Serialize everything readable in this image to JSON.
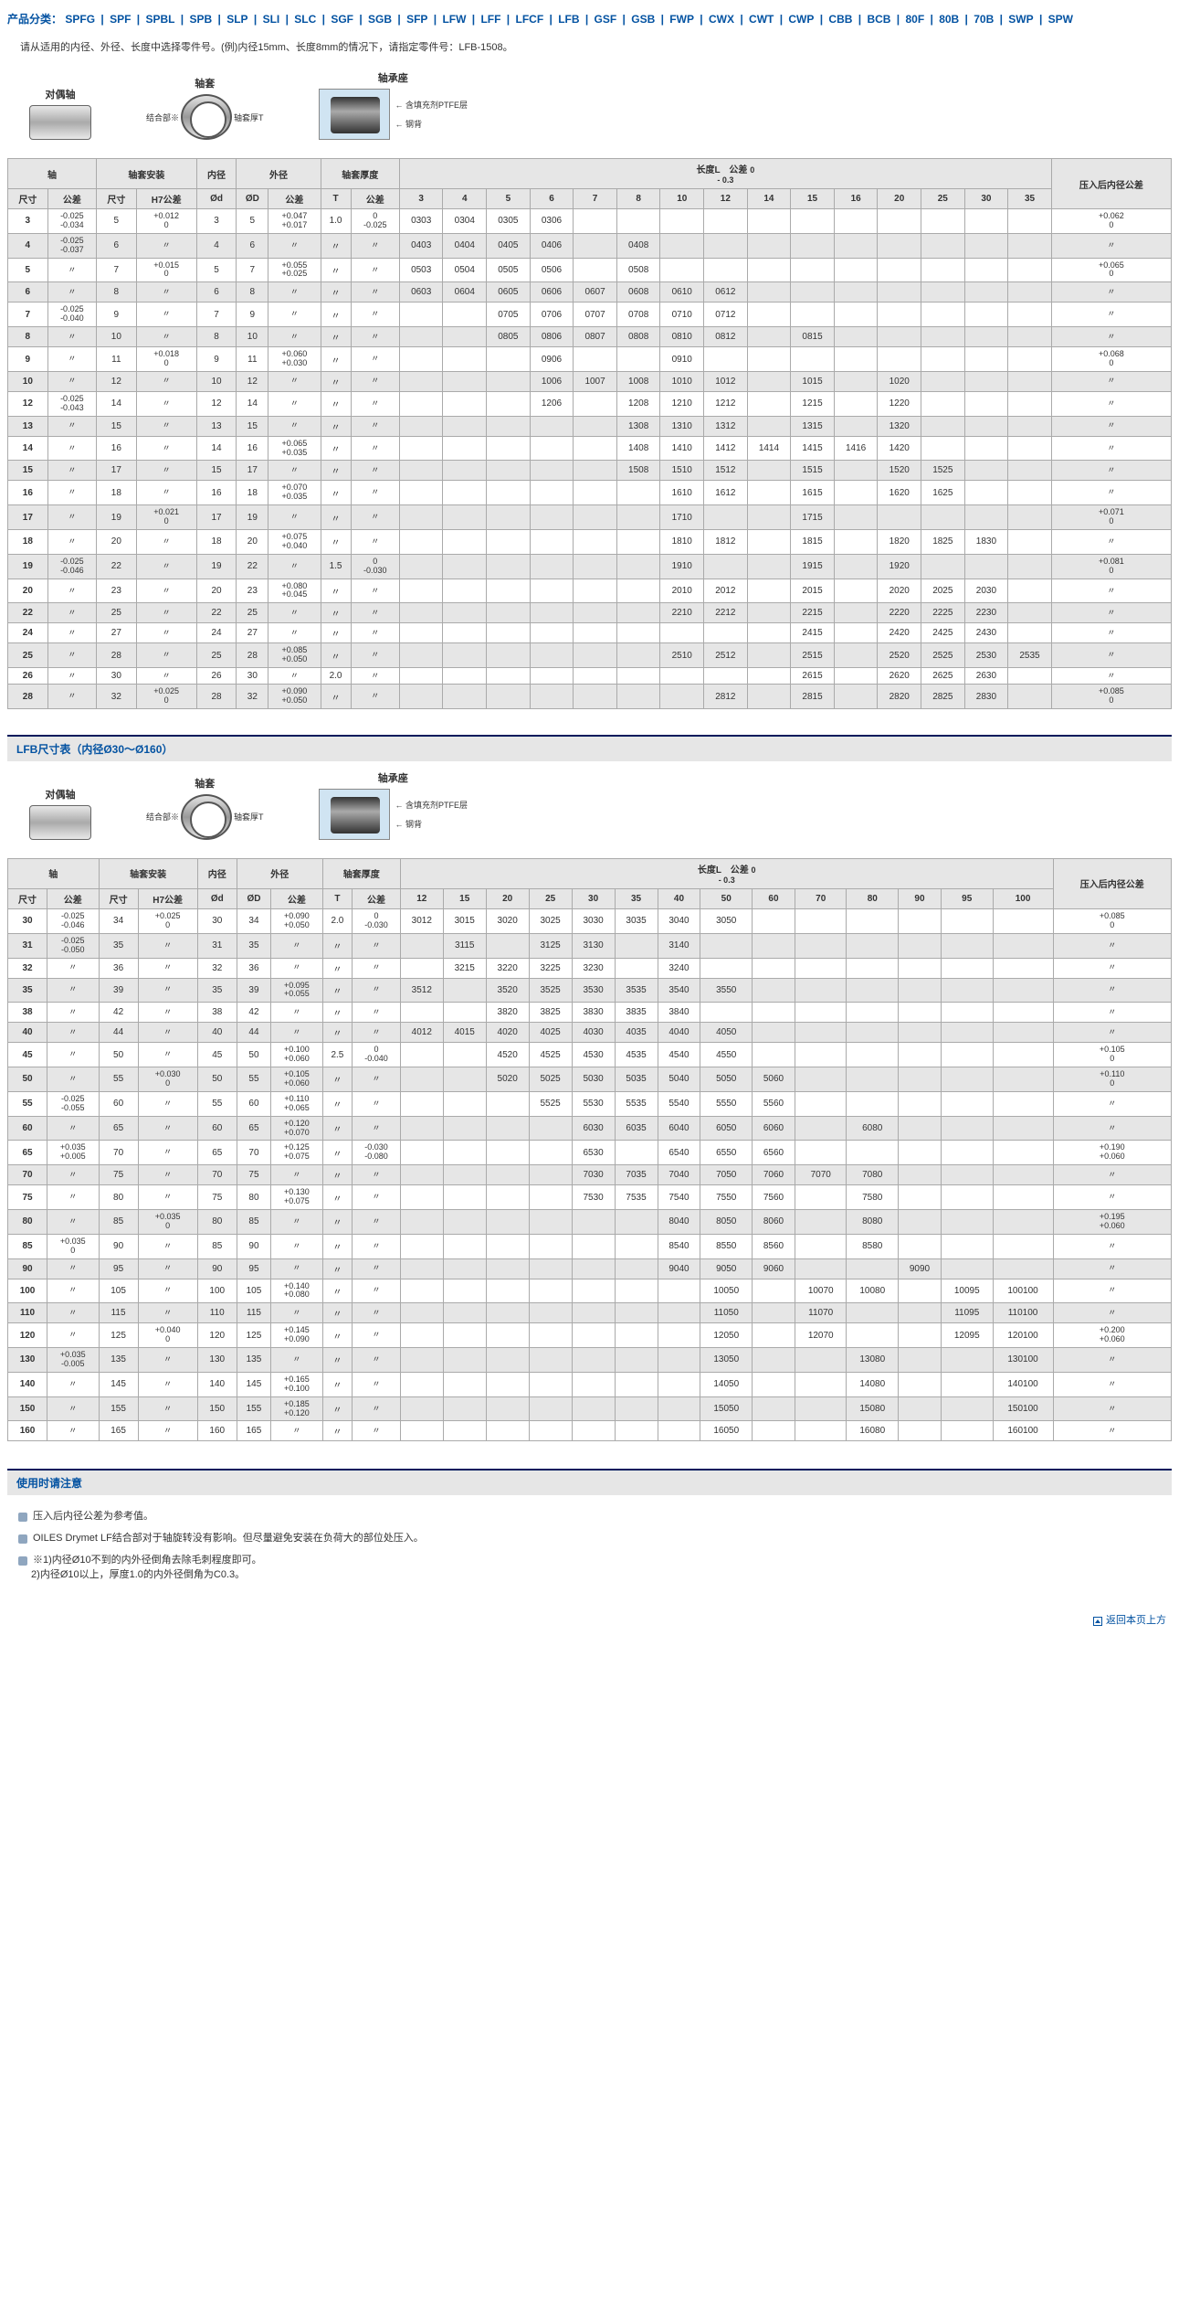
{
  "categories_label": "产品分类：",
  "categories": [
    "SPFG",
    "SPF",
    "SPBL",
    "SPB",
    "SLP",
    "SLI",
    "SLC",
    "SGF",
    "SGB",
    "SFP",
    "LFW",
    "LFF",
    "LFCF",
    "LFB",
    "GSF",
    "GSB",
    "FWP",
    "CWX",
    "CWT",
    "CWP",
    "CBB",
    "BCB",
    "80F",
    "80B",
    "70B",
    "SWP",
    "SPW"
  ],
  "top_note": "请从适用的内径、外径、长度中选择零件号。(例)内径15mm、长度8mm的情况下，请指定零件号：LFB-1508。",
  "diag1": "对偶轴",
  "diag2": "轴套",
  "diag3": "轴承座",
  "diag2_sub1": "结合部※",
  "diag2_sub2": "轴套厚T",
  "diag3_sub1": "含填充剂PTFE层",
  "diag3_sub2": "钢背",
  "section2": "LFB尺寸表（内径Ø30～Ø160）",
  "use_title": "使用时请注意",
  "use_items": [
    "压入后内径公差为参考值。",
    "OILES Drymet LF结合部对于轴旋转没有影响。但尽量避免安装在负荷大的部位处压入。",
    "※1)内径Ø10不到的内外径倒角去除毛刺程度即可。\n　 2)内径Ø10以上，厚度1.0的内外径倒角为C0.3。"
  ],
  "back_top": "返回本页上方",
  "h1": {
    "shaft": "轴",
    "mount": "轴套安装",
    "id": "内径",
    "od": "外径",
    "thick": "轴套厚度",
    "length": "长度L",
    "length_tol": "公差",
    "press": "压入后内径公差",
    "dim": "尺寸",
    "tol": "公差",
    "h7": "H7公差",
    "phid": "Ød",
    "phiD": "ØD",
    "T": "T"
  },
  "len_tol1": "0\n- 0.3",
  "len_tol2": "0\n- 0.3",
  "t1": {
    "lengths": [
      "3",
      "4",
      "5",
      "6",
      "7",
      "8",
      "10",
      "12",
      "14",
      "15",
      "16",
      "20",
      "25",
      "30",
      "35"
    ],
    "rows": [
      {
        "d": "3",
        "dt": "-0.025\n-0.034",
        "m": "5",
        "mt": "+0.012\n0",
        "id": "3",
        "od": "5",
        "odt": "+0.047\n+0.017",
        "t": "1.0",
        "tt": "0\n-0.025",
        "c": {
          "3": "0303",
          "4": "0304",
          "5": "0305",
          "6": "0306"
        },
        "p": "+0.062\n0"
      },
      {
        "d": "4",
        "dt": "-0.025\n-0.037",
        "m": "6",
        "mt": "〃",
        "id": "4",
        "od": "6",
        "odt": "〃",
        "t": "〃",
        "tt": "〃",
        "c": {
          "3": "0403",
          "4": "0404",
          "5": "0405",
          "6": "0406",
          "8": "0408"
        },
        "p": "〃"
      },
      {
        "d": "5",
        "dt": "〃",
        "m": "7",
        "mt": "+0.015\n0",
        "id": "5",
        "od": "7",
        "odt": "+0.055\n+0.025",
        "t": "〃",
        "tt": "〃",
        "c": {
          "3": "0503",
          "4": "0504",
          "5": "0505",
          "6": "0506",
          "8": "0508"
        },
        "p": "+0.065\n0"
      },
      {
        "d": "6",
        "dt": "〃",
        "m": "8",
        "mt": "〃",
        "id": "6",
        "od": "8",
        "odt": "〃",
        "t": "〃",
        "tt": "〃",
        "c": {
          "3": "0603",
          "4": "0604",
          "5": "0605",
          "6": "0606",
          "7": "0607",
          "8": "0608",
          "10": "0610",
          "12": "0612"
        },
        "p": "〃"
      },
      {
        "d": "7",
        "dt": "-0.025\n-0.040",
        "m": "9",
        "mt": "〃",
        "id": "7",
        "od": "9",
        "odt": "〃",
        "t": "〃",
        "tt": "〃",
        "c": {
          "5": "0705",
          "6": "0706",
          "7": "0707",
          "8": "0708",
          "10": "0710",
          "12": "0712"
        },
        "p": "〃"
      },
      {
        "d": "8",
        "dt": "〃",
        "m": "10",
        "mt": "〃",
        "id": "8",
        "od": "10",
        "odt": "〃",
        "t": "〃",
        "tt": "〃",
        "c": {
          "5": "0805",
          "6": "0806",
          "7": "0807",
          "8": "0808",
          "10": "0810",
          "12": "0812",
          "15": "0815"
        },
        "p": "〃"
      },
      {
        "d": "9",
        "dt": "〃",
        "m": "11",
        "mt": "+0.018\n0",
        "id": "9",
        "od": "11",
        "odt": "+0.060\n+0.030",
        "t": "〃",
        "tt": "〃",
        "c": {
          "6": "0906",
          "10": "0910"
        },
        "p": "+0.068\n0"
      },
      {
        "d": "10",
        "dt": "〃",
        "m": "12",
        "mt": "〃",
        "id": "10",
        "od": "12",
        "odt": "〃",
        "t": "〃",
        "tt": "〃",
        "c": {
          "6": "1006",
          "7": "1007",
          "8": "1008",
          "10": "1010",
          "12": "1012",
          "15": "1015",
          "20": "1020"
        },
        "p": "〃"
      },
      {
        "d": "12",
        "dt": "-0.025\n-0.043",
        "m": "14",
        "mt": "〃",
        "id": "12",
        "od": "14",
        "odt": "〃",
        "t": "〃",
        "tt": "〃",
        "c": {
          "6": "1206",
          "8": "1208",
          "10": "1210",
          "12": "1212",
          "15": "1215",
          "20": "1220"
        },
        "p": "〃"
      },
      {
        "d": "13",
        "dt": "〃",
        "m": "15",
        "mt": "〃",
        "id": "13",
        "od": "15",
        "odt": "〃",
        "t": "〃",
        "tt": "〃",
        "c": {
          "8": "1308",
          "10": "1310",
          "12": "1312",
          "15": "1315",
          "20": "1320"
        },
        "p": "〃"
      },
      {
        "d": "14",
        "dt": "〃",
        "m": "16",
        "mt": "〃",
        "id": "14",
        "od": "16",
        "odt": "+0.065\n+0.035",
        "t": "〃",
        "tt": "〃",
        "c": {
          "8": "1408",
          "10": "1410",
          "12": "1412",
          "14": "1414",
          "15": "1415",
          "16": "1416",
          "20": "1420"
        },
        "p": "〃"
      },
      {
        "d": "15",
        "dt": "〃",
        "m": "17",
        "mt": "〃",
        "id": "15",
        "od": "17",
        "odt": "〃",
        "t": "〃",
        "tt": "〃",
        "c": {
          "8": "1508",
          "10": "1510",
          "12": "1512",
          "15": "1515",
          "20": "1520",
          "25": "1525"
        },
        "p": "〃"
      },
      {
        "d": "16",
        "dt": "〃",
        "m": "18",
        "mt": "〃",
        "id": "16",
        "od": "18",
        "odt": "+0.070\n+0.035",
        "t": "〃",
        "tt": "〃",
        "c": {
          "10": "1610",
          "12": "1612",
          "15": "1615",
          "20": "1620",
          "25": "1625"
        },
        "p": "〃"
      },
      {
        "d": "17",
        "dt": "〃",
        "m": "19",
        "mt": "+0.021\n0",
        "id": "17",
        "od": "19",
        "odt": "〃",
        "t": "〃",
        "tt": "〃",
        "c": {
          "10": "1710",
          "15": "1715"
        },
        "p": "+0.071\n0"
      },
      {
        "d": "18",
        "dt": "〃",
        "m": "20",
        "mt": "〃",
        "id": "18",
        "od": "20",
        "odt": "+0.075\n+0.040",
        "t": "〃",
        "tt": "〃",
        "c": {
          "10": "1810",
          "12": "1812",
          "15": "1815",
          "20": "1820",
          "25": "1825",
          "30": "1830"
        },
        "p": "〃"
      },
      {
        "d": "19",
        "dt": "-0.025\n-0.046",
        "m": "22",
        "mt": "〃",
        "id": "19",
        "od": "22",
        "odt": "〃",
        "t": "1.5",
        "tt": "0\n-0.030",
        "c": {
          "10": "1910",
          "15": "1915",
          "20": "1920"
        },
        "p": "+0.081\n0"
      },
      {
        "d": "20",
        "dt": "〃",
        "m": "23",
        "mt": "〃",
        "id": "20",
        "od": "23",
        "odt": "+0.080\n+0.045",
        "t": "〃",
        "tt": "〃",
        "c": {
          "10": "2010",
          "12": "2012",
          "15": "2015",
          "20": "2020",
          "25": "2025",
          "30": "2030"
        },
        "p": "〃"
      },
      {
        "d": "22",
        "dt": "〃",
        "m": "25",
        "mt": "〃",
        "id": "22",
        "od": "25",
        "odt": "〃",
        "t": "〃",
        "tt": "〃",
        "c": {
          "10": "2210",
          "12": "2212",
          "15": "2215",
          "20": "2220",
          "25": "2225",
          "30": "2230"
        },
        "p": "〃"
      },
      {
        "d": "24",
        "dt": "〃",
        "m": "27",
        "mt": "〃",
        "id": "24",
        "od": "27",
        "odt": "〃",
        "t": "〃",
        "tt": "〃",
        "c": {
          "15": "2415",
          "20": "2420",
          "25": "2425",
          "30": "2430"
        },
        "p": "〃"
      },
      {
        "d": "25",
        "dt": "〃",
        "m": "28",
        "mt": "〃",
        "id": "25",
        "od": "28",
        "odt": "+0.085\n+0.050",
        "t": "〃",
        "tt": "〃",
        "c": {
          "10": "2510",
          "12": "2512",
          "15": "2515",
          "20": "2520",
          "25": "2525",
          "30": "2530",
          "35": "2535"
        },
        "p": "〃"
      },
      {
        "d": "26",
        "dt": "〃",
        "m": "30",
        "mt": "〃",
        "id": "26",
        "od": "30",
        "odt": "〃",
        "t": "2.0",
        "tt": "〃",
        "c": {
          "15": "2615",
          "20": "2620",
          "25": "2625",
          "30": "2630"
        },
        "p": "〃"
      },
      {
        "d": "28",
        "dt": "〃",
        "m": "32",
        "mt": "+0.025\n0",
        "id": "28",
        "od": "32",
        "odt": "+0.090\n+0.050",
        "t": "〃",
        "tt": "〃",
        "c": {
          "12": "2812",
          "15": "2815",
          "20": "2820",
          "25": "2825",
          "30": "2830"
        },
        "p": "+0.085\n0"
      }
    ]
  },
  "t2": {
    "lengths": [
      "12",
      "15",
      "20",
      "25",
      "30",
      "35",
      "40",
      "50",
      "60",
      "70",
      "80",
      "90",
      "95",
      "100"
    ],
    "rows": [
      {
        "d": "30",
        "dt": "-0.025\n-0.046",
        "m": "34",
        "mt": "+0.025\n0",
        "id": "30",
        "od": "34",
        "odt": "+0.090\n+0.050",
        "t": "2.0",
        "tt": "0\n-0.030",
        "c": {
          "12": "3012",
          "15": "3015",
          "20": "3020",
          "25": "3025",
          "30": "3030",
          "35": "3035",
          "40": "3040",
          "50": "3050"
        },
        "p": "+0.085\n0"
      },
      {
        "d": "31",
        "dt": "-0.025\n-0.050",
        "m": "35",
        "mt": "〃",
        "id": "31",
        "od": "35",
        "odt": "〃",
        "t": "〃",
        "tt": "〃",
        "c": {
          "15": "3115",
          "25": "3125",
          "30": "3130",
          "40": "3140"
        },
        "p": "〃"
      },
      {
        "d": "32",
        "dt": "〃",
        "m": "36",
        "mt": "〃",
        "id": "32",
        "od": "36",
        "odt": "〃",
        "t": "〃",
        "tt": "〃",
        "c": {
          "15": "3215",
          "20": "3220",
          "25": "3225",
          "30": "3230",
          "40": "3240"
        },
        "p": "〃"
      },
      {
        "d": "35",
        "dt": "〃",
        "m": "39",
        "mt": "〃",
        "id": "35",
        "od": "39",
        "odt": "+0.095\n+0.055",
        "t": "〃",
        "tt": "〃",
        "c": {
          "12": "3512",
          "20": "3520",
          "25": "3525",
          "30": "3530",
          "35": "3535",
          "40": "3540",
          "50": "3550"
        },
        "p": "〃"
      },
      {
        "d": "38",
        "dt": "〃",
        "m": "42",
        "mt": "〃",
        "id": "38",
        "od": "42",
        "odt": "〃",
        "t": "〃",
        "tt": "〃",
        "c": {
          "20": "3820",
          "25": "3825",
          "30": "3830",
          "35": "3835",
          "40": "3840"
        },
        "p": "〃"
      },
      {
        "d": "40",
        "dt": "〃",
        "m": "44",
        "mt": "〃",
        "id": "40",
        "od": "44",
        "odt": "〃",
        "t": "〃",
        "tt": "〃",
        "c": {
          "12": "4012",
          "15": "4015",
          "20": "4020",
          "25": "4025",
          "30": "4030",
          "35": "4035",
          "40": "4040",
          "50": "4050"
        },
        "p": "〃"
      },
      {
        "d": "45",
        "dt": "〃",
        "m": "50",
        "mt": "〃",
        "id": "45",
        "od": "50",
        "odt": "+0.100\n+0.060",
        "t": "2.5",
        "tt": "0\n-0.040",
        "c": {
          "20": "4520",
          "25": "4525",
          "30": "4530",
          "35": "4535",
          "40": "4540",
          "50": "4550"
        },
        "p": "+0.105\n0"
      },
      {
        "d": "50",
        "dt": "〃",
        "m": "55",
        "mt": "+0.030\n0",
        "id": "50",
        "od": "55",
        "odt": "+0.105\n+0.060",
        "t": "〃",
        "tt": "〃",
        "c": {
          "20": "5020",
          "25": "5025",
          "30": "5030",
          "35": "5035",
          "40": "5040",
          "50": "5050",
          "60": "5060"
        },
        "p": "+0.110\n0"
      },
      {
        "d": "55",
        "dt": "-0.025\n-0.055",
        "m": "60",
        "mt": "〃",
        "id": "55",
        "od": "60",
        "odt": "+0.110\n+0.065",
        "t": "〃",
        "tt": "〃",
        "c": {
          "25": "5525",
          "30": "5530",
          "35": "5535",
          "40": "5540",
          "50": "5550",
          "60": "5560"
        },
        "p": "〃"
      },
      {
        "d": "60",
        "dt": "〃",
        "m": "65",
        "mt": "〃",
        "id": "60",
        "od": "65",
        "odt": "+0.120\n+0.070",
        "t": "〃",
        "tt": "〃",
        "c": {
          "30": "6030",
          "35": "6035",
          "40": "6040",
          "50": "6050",
          "60": "6060",
          "80": "6080"
        },
        "p": "〃"
      },
      {
        "d": "65",
        "dt": "+0.035\n+0.005",
        "m": "70",
        "mt": "〃",
        "id": "65",
        "od": "70",
        "odt": "+0.125\n+0.075",
        "t": "〃",
        "tt": "-0.030\n-0.080",
        "c": {
          "30": "6530",
          "40": "6540",
          "50": "6550",
          "60": "6560"
        },
        "p": "+0.190\n+0.060"
      },
      {
        "d": "70",
        "dt": "〃",
        "m": "75",
        "mt": "〃",
        "id": "70",
        "od": "75",
        "odt": "〃",
        "t": "〃",
        "tt": "〃",
        "c": {
          "30": "7030",
          "35": "7035",
          "40": "7040",
          "50": "7050",
          "60": "7060",
          "70": "7070",
          "80": "7080"
        },
        "p": "〃"
      },
      {
        "d": "75",
        "dt": "〃",
        "m": "80",
        "mt": "〃",
        "id": "75",
        "od": "80",
        "odt": "+0.130\n+0.075",
        "t": "〃",
        "tt": "〃",
        "c": {
          "30": "7530",
          "35": "7535",
          "40": "7540",
          "50": "7550",
          "60": "7560",
          "80": "7580"
        },
        "p": "〃"
      },
      {
        "d": "80",
        "dt": "〃",
        "m": "85",
        "mt": "+0.035\n0",
        "id": "80",
        "od": "85",
        "odt": "〃",
        "t": "〃",
        "tt": "〃",
        "c": {
          "40": "8040",
          "50": "8050",
          "60": "8060",
          "80": "8080"
        },
        "p": "+0.195\n+0.060"
      },
      {
        "d": "85",
        "dt": "+0.035\n0",
        "m": "90",
        "mt": "〃",
        "id": "85",
        "od": "90",
        "odt": "〃",
        "t": "〃",
        "tt": "〃",
        "c": {
          "40": "8540",
          "50": "8550",
          "60": "8560",
          "80": "8580"
        },
        "p": "〃"
      },
      {
        "d": "90",
        "dt": "〃",
        "m": "95",
        "mt": "〃",
        "id": "90",
        "od": "95",
        "odt": "〃",
        "t": "〃",
        "tt": "〃",
        "c": {
          "40": "9040",
          "50": "9050",
          "60": "9060",
          "90": "9090"
        },
        "p": "〃"
      },
      {
        "d": "100",
        "dt": "〃",
        "m": "105",
        "mt": "〃",
        "id": "100",
        "od": "105",
        "odt": "+0.140\n+0.080",
        "t": "〃",
        "tt": "〃",
        "c": {
          "50": "10050",
          "70": "10070",
          "80": "10080",
          "95": "10095",
          "100": "100100"
        },
        "p": "〃"
      },
      {
        "d": "110",
        "dt": "〃",
        "m": "115",
        "mt": "〃",
        "id": "110",
        "od": "115",
        "odt": "〃",
        "t": "〃",
        "tt": "〃",
        "c": {
          "50": "11050",
          "70": "11070",
          "95": "11095",
          "100": "110100"
        },
        "p": "〃"
      },
      {
        "d": "120",
        "dt": "〃",
        "m": "125",
        "mt": "+0.040\n0",
        "id": "120",
        "od": "125",
        "odt": "+0.145\n+0.090",
        "t": "〃",
        "tt": "〃",
        "c": {
          "50": "12050",
          "70": "12070",
          "95": "12095",
          "100": "120100"
        },
        "p": "+0.200\n+0.060"
      },
      {
        "d": "130",
        "dt": "+0.035\n-0.005",
        "m": "135",
        "mt": "〃",
        "id": "130",
        "od": "135",
        "odt": "〃",
        "t": "〃",
        "tt": "〃",
        "c": {
          "50": "13050",
          "80": "13080",
          "100": "130100"
        },
        "p": "〃"
      },
      {
        "d": "140",
        "dt": "〃",
        "m": "145",
        "mt": "〃",
        "id": "140",
        "od": "145",
        "odt": "+0.165\n+0.100",
        "t": "〃",
        "tt": "〃",
        "c": {
          "50": "14050",
          "80": "14080",
          "100": "140100"
        },
        "p": "〃"
      },
      {
        "d": "150",
        "dt": "〃",
        "m": "155",
        "mt": "〃",
        "id": "150",
        "od": "155",
        "odt": "+0.185\n+0.120",
        "t": "〃",
        "tt": "〃",
        "c": {
          "50": "15050",
          "80": "15080",
          "100": "150100"
        },
        "p": "〃"
      },
      {
        "d": "160",
        "dt": "〃",
        "m": "165",
        "mt": "〃",
        "id": "160",
        "od": "165",
        "odt": "〃",
        "t": "〃",
        "tt": "〃",
        "c": {
          "50": "16050",
          "80": "16080",
          "100": "160100"
        },
        "p": "〃"
      }
    ]
  }
}
